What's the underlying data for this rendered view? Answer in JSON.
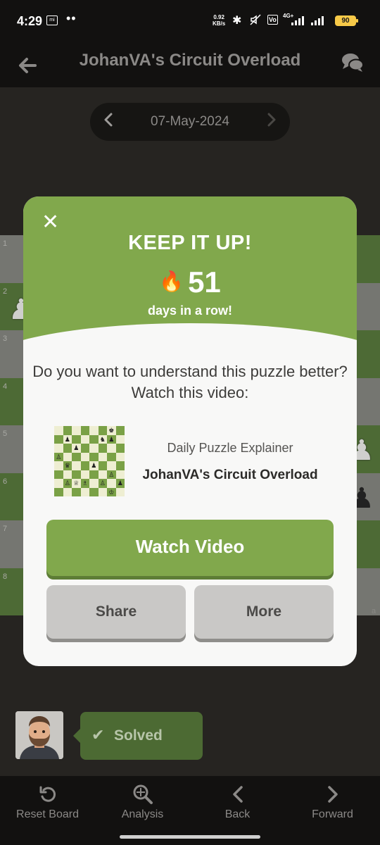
{
  "status_bar": {
    "time": "4:29",
    "speed_value": "0.92",
    "speed_unit": "KB/s",
    "battery": "90",
    "network_label": "4G+"
  },
  "header": {
    "title": "JohanVA's Circuit Overload"
  },
  "date_nav": {
    "date": "07-May-2024"
  },
  "board": {
    "rank_labels": [
      "1",
      "2",
      "3",
      "4",
      "5",
      "6",
      "7",
      "8"
    ],
    "file_label": "a"
  },
  "modal": {
    "close_glyph": "✕",
    "title": "KEEP IT UP!",
    "streak_count": "51",
    "streak_caption": "days in a row!",
    "question": "Do you want to understand this puzzle better? Watch this video:",
    "video_subtitle": "Daily Puzzle Explainer",
    "video_title": "JohanVA's Circuit Overload",
    "watch_label": "Watch Video",
    "share_label": "Share",
    "more_label": "More"
  },
  "result": {
    "status": "Solved"
  },
  "bottom_nav": {
    "items": [
      {
        "label": "Reset Board",
        "icon": "reset-icon"
      },
      {
        "label": "Analysis",
        "icon": "analysis-icon"
      },
      {
        "label": "Back",
        "icon": "chevron-left-icon"
      },
      {
        "label": "Forward",
        "icon": "chevron-right-icon"
      }
    ]
  },
  "colors": {
    "accent_green": "#81a84c",
    "background": "#262421",
    "modal_bg": "#f8f8f7"
  }
}
